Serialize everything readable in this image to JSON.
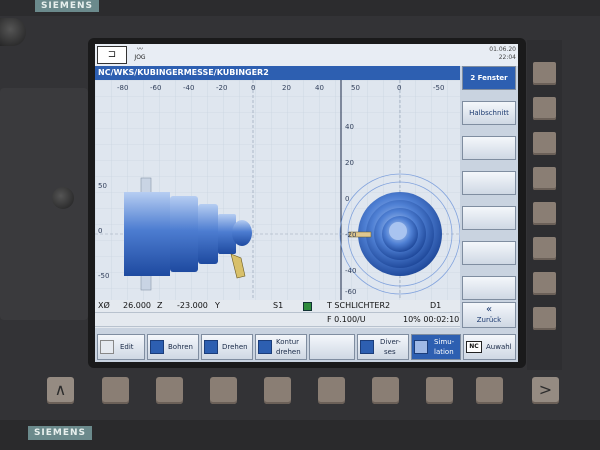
{
  "hardware": {
    "brand_top": "SIEMENS",
    "brand_bottom": "SIEMENS",
    "bottom_left_arrow": "∧",
    "bottom_right_arrow": ">"
  },
  "header": {
    "mode_label": "JOG",
    "date": "01.06.20",
    "time": "22:04"
  },
  "path_bar": "NC/WKS/KUBINGERMESSE/KUBINGER2",
  "side_view_axis": {
    "x_ticks": [
      "-80",
      "-60",
      "-40",
      "-20",
      "0",
      "20",
      "40"
    ],
    "y_ticks": [
      "50",
      "0",
      "-50"
    ]
  },
  "front_view_axis": {
    "x_ticks": [
      "50",
      "0",
      "-50"
    ],
    "y_ticks": [
      "40",
      "20",
      "0",
      "-20",
      "-40",
      "-60"
    ]
  },
  "info": {
    "x_label": "XØ",
    "x_value": "26.000",
    "z_label": "Z",
    "z_value": "-23.000",
    "y_label": "Y",
    "spindle": "S1",
    "tool": "T SCHLICHTER2",
    "d": "D1",
    "feed": "F 0.100/U",
    "progress": "10% 00:02:10"
  },
  "right_softkeys": [
    {
      "label": "2 Fenster",
      "active": true
    },
    {
      "label": "Halbschnitt",
      "active": false
    },
    {
      "label": "",
      "active": false
    },
    {
      "label": "",
      "active": false
    },
    {
      "label": "",
      "active": false
    },
    {
      "label": "",
      "active": false
    },
    {
      "label": "",
      "active": false
    }
  ],
  "back_button": {
    "arrow": "«",
    "label": "Zurück"
  },
  "bottom_softkeys": {
    "edit": "Edit",
    "bohren": "Bohren",
    "drehen": "Drehen",
    "kontur_1": "Kontur",
    "kontur_2": "drehen",
    "diverses_1": "Diver-",
    "diverses_2": "ses",
    "simulation_1": "Simu-",
    "simulation_2": "lation",
    "auswahl": "Auwahl",
    "nc_badge": "NC"
  },
  "colors": {
    "accent": "#2d5fb1",
    "part_blue": "#5a86d6",
    "tool_yellow": "#d8c06a"
  }
}
